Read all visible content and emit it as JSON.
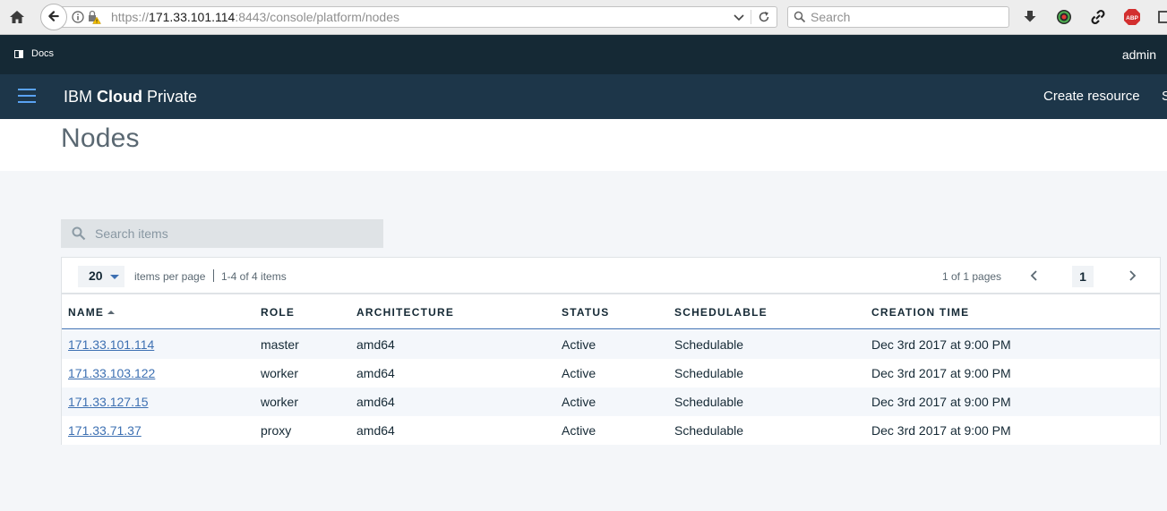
{
  "browser": {
    "url_protocol": "https://",
    "url_host": "171.33.101.114",
    "url_rest": ":8443/console/platform/nodes",
    "search_placeholder": "Search"
  },
  "header": {
    "docs_label": "Docs",
    "user": "admin",
    "brand_prefix": "IBM ",
    "brand_bold": "Cloud",
    "brand_suffix": " Private",
    "create_resource": "Create resource",
    "cutoff_item": "S"
  },
  "page": {
    "title": "Nodes"
  },
  "search": {
    "placeholder": "Search items"
  },
  "pagination": {
    "per_page": "20",
    "per_page_label": "items per page",
    "range": "1-4 of 4 items",
    "pages": "1 of 1 pages",
    "current_page": "1"
  },
  "table": {
    "columns": [
      "NAME",
      "ROLE",
      "ARCHITECTURE",
      "STATUS",
      "SCHEDULABLE",
      "CREATION TIME"
    ],
    "rows": [
      {
        "name": "171.33.101.114",
        "role": "master",
        "arch": "amd64",
        "status": "Active",
        "schedulable": "Schedulable",
        "created": "Dec 3rd 2017 at 9:00 PM"
      },
      {
        "name": "171.33.103.122",
        "role": "worker",
        "arch": "amd64",
        "status": "Active",
        "schedulable": "Schedulable",
        "created": "Dec 3rd 2017 at 9:00 PM"
      },
      {
        "name": "171.33.127.15",
        "role": "worker",
        "arch": "amd64",
        "status": "Active",
        "schedulable": "Schedulable",
        "created": "Dec 3rd 2017 at 9:00 PM"
      },
      {
        "name": "171.33.71.37",
        "role": "proxy",
        "arch": "amd64",
        "status": "Active",
        "schedulable": "Schedulable",
        "created": "Dec 3rd 2017 at 9:00 PM"
      }
    ]
  },
  "colors": {
    "header_dark": "#152935",
    "app_bar": "#1d3649",
    "accent": "#3d70b2",
    "link": "#3d70b2"
  }
}
